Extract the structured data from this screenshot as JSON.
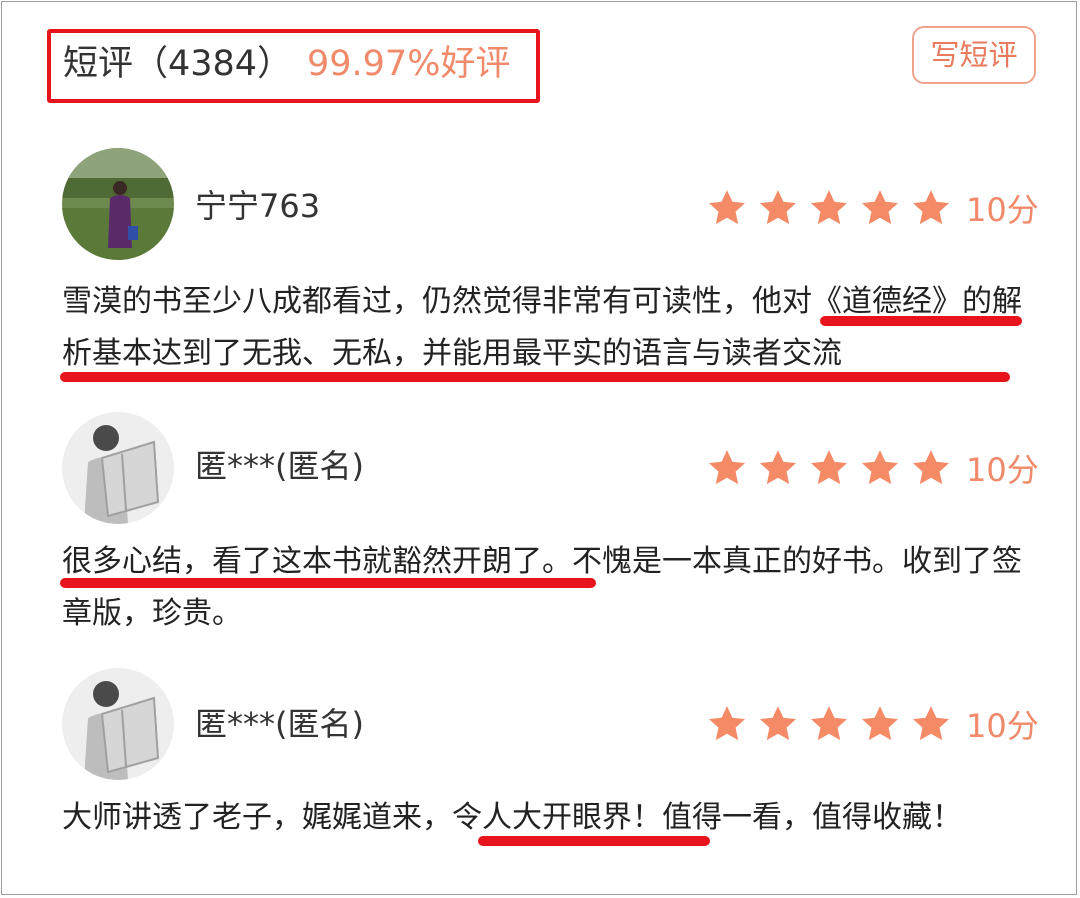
{
  "header": {
    "title": "短评（4384）",
    "rating": "99.97%好评",
    "write_button": "写短评"
  },
  "colors": {
    "accent": "#f08a6a",
    "highlight": "#e8141b",
    "star": "#f58a67"
  },
  "reviews": [
    {
      "username": "宁宁763",
      "avatar": "photo-avatar",
      "stars": 5,
      "score": "10分",
      "comment_plain": "雪漠的书至少八成都看过，仍然觉得非常有可读性，",
      "comment_highlight": "他对《道德经》的解析基本达到了无我、无私，并能用最平实的语言与读者交流",
      "comment_tail": ""
    },
    {
      "username": "匿***(匿名)",
      "avatar": "default-reader-avatar",
      "stars": 5,
      "score": "10分",
      "comment_plain": "",
      "comment_highlight": "很多心结，看了这本书就豁然开朗了",
      "comment_tail": "。不愧是一本真正的好书。收到了签章版，珍贵。"
    },
    {
      "username": "匿***(匿名)",
      "avatar": "default-reader-avatar",
      "stars": 5,
      "score": "10分",
      "comment_plain": "大师讲透了老子，娓娓道来，",
      "comment_highlight": "令人大开眼界！",
      "comment_tail": "值得一看，值得收藏！"
    }
  ]
}
